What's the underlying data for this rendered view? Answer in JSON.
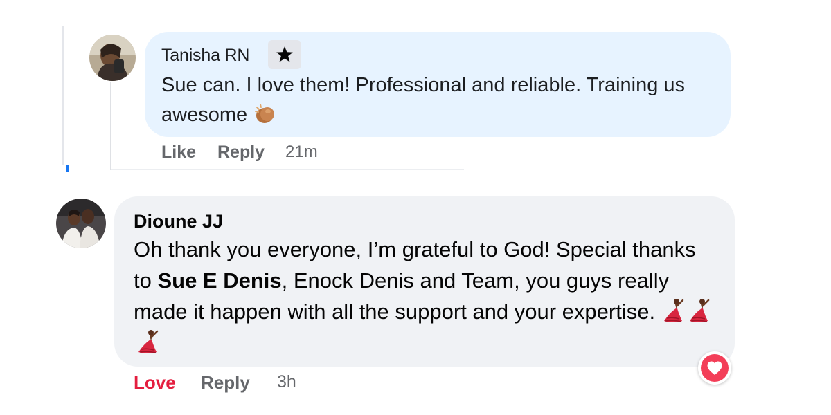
{
  "comments": [
    {
      "author": "Tanisha RN",
      "badge_icon": "star-icon",
      "text": "Sue can. I love them! Professional and reliable. Training us awesome",
      "emoji": "clapping-hands",
      "actions": {
        "like": "Like",
        "reply": "Reply",
        "time": "21m"
      }
    },
    {
      "author": "Dioune JJ",
      "text_before": "Oh thank you everyone, I’m grateful to God! Special thanks to ",
      "mention": "Sue E Denis",
      "text_after": ", Enock Denis and Team, you guys really made it happen with all the support and your expertise.",
      "emoji": "dancing-woman",
      "emoji_count": 3,
      "actions": {
        "love": "Love",
        "reply": "Reply",
        "time": "3h"
      },
      "reaction": "heart"
    }
  ],
  "colors": {
    "bubble_reply": "#e7f3ff",
    "bubble_comment": "#f0f2f5",
    "love_red": "#e41e3f",
    "meta_gray": "#65676b",
    "thread_blue": "#1877f2"
  }
}
